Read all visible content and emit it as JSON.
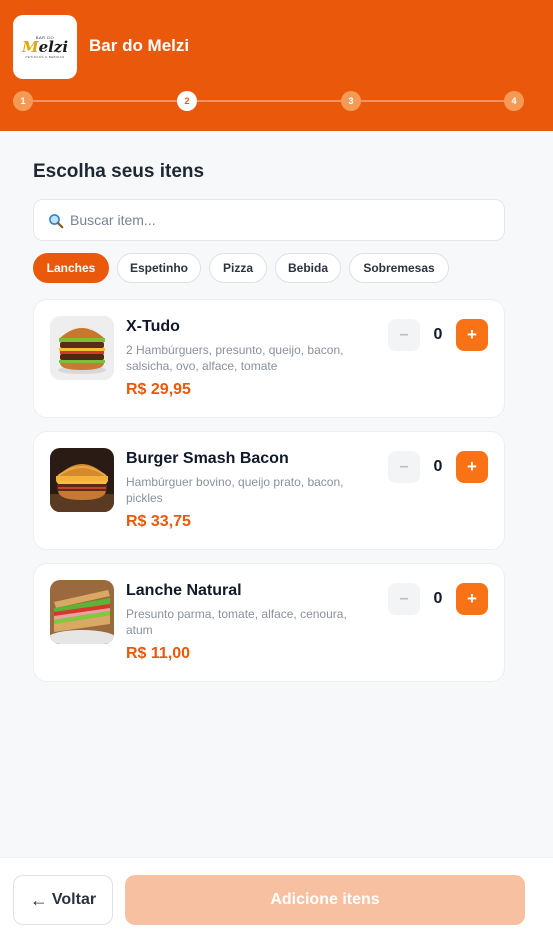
{
  "header": {
    "logo": {
      "small": "BAR DO",
      "main_first": "M",
      "main_rest": "elzi",
      "sub": "PETISCOS & BEBIDAS"
    },
    "brand_name": "Bar do Melzi",
    "steps": [
      "1",
      "2",
      "3",
      "4"
    ],
    "active_step": 2
  },
  "main": {
    "title": "Escolha seus itens",
    "search": {
      "placeholder": "Buscar item...",
      "value": ""
    },
    "categories": [
      {
        "label": "Lanches",
        "active": true
      },
      {
        "label": "Espetinho",
        "active": false
      },
      {
        "label": "Pizza",
        "active": false
      },
      {
        "label": "Bebida",
        "active": false
      },
      {
        "label": "Sobremesas",
        "active": false
      }
    ],
    "items": [
      {
        "name": "X-Tudo",
        "description": "2 Hambúrguers, presunto, queijo, bacon, salsicha, ovo, alface, tomate",
        "price": "R$ 29,95",
        "quantity": "0",
        "minus": "–",
        "plus": "+",
        "image": "burger-stack-photo"
      },
      {
        "name": "Burger Smash Bacon",
        "description": "Hambúrguer bovino, queijo prato, bacon, pickles",
        "price": "R$ 33,75",
        "quantity": "0",
        "minus": "–",
        "plus": "+",
        "image": "smash-burger-photo"
      },
      {
        "name": "Lanche Natural",
        "description": "Presunto parma, tomate, alface, cenoura, atum",
        "price": "R$ 11,00",
        "quantity": "0",
        "minus": "–",
        "plus": "+",
        "image": "sandwich-photo"
      }
    ]
  },
  "footer": {
    "back_arrow": "←",
    "back_label": "Voltar",
    "add_label": "Adicione itens"
  },
  "colors": {
    "brand": "#ea580c",
    "accent": "#f97316",
    "disabled_button": "#f7c1a1"
  }
}
